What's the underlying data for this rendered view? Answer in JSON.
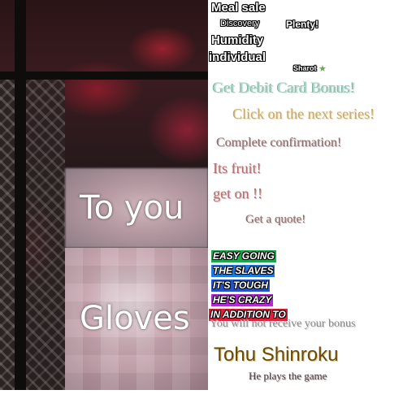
{
  "art": {
    "text_top": "To you",
    "text_bottom": "Gloves"
  },
  "labels": {
    "meal_sale": "Meal sale",
    "discovery": "Discovery",
    "plenty": "Plenty!",
    "humidity": "Humidity",
    "individual": "individual",
    "sharot": "Sharot",
    "debit_card": "Get Debit Card Bonus!",
    "next_series": "Click on the next series!",
    "complete_confirmation": "Complete confirmation!",
    "its_fruit": "Its fruit!",
    "get_on": "get on !!",
    "get_quote": "Get a quote!",
    "no_bonus": "You will not receive your bonus",
    "tohu_shinroku": "Tohu Shinroku",
    "plays_game": "He plays the game"
  },
  "tags": [
    {
      "text": "EASY GOING",
      "bg": "#1aa84a"
    },
    {
      "text": "THE SLAVES",
      "bg": "#1e78e0"
    },
    {
      "text": "IT'S TOUGH",
      "bg": "#2255cc"
    },
    {
      "text": "HE'S CRAZY",
      "bg": "#b02ad0"
    },
    {
      "text": "IN ADDITION TO",
      "bg": "#e0203a"
    }
  ],
  "colors": {
    "debit": "#a8d2c4",
    "series": "#c9a86a",
    "confirm": "#8c6d6e",
    "fruit": "#b27070",
    "quote": "#8e6b6b",
    "no_bonus": "#8a8a8a",
    "tohu": "#6a4a08",
    "plays": "#4a3a3a"
  },
  "icons": {
    "star": "star-icon"
  }
}
